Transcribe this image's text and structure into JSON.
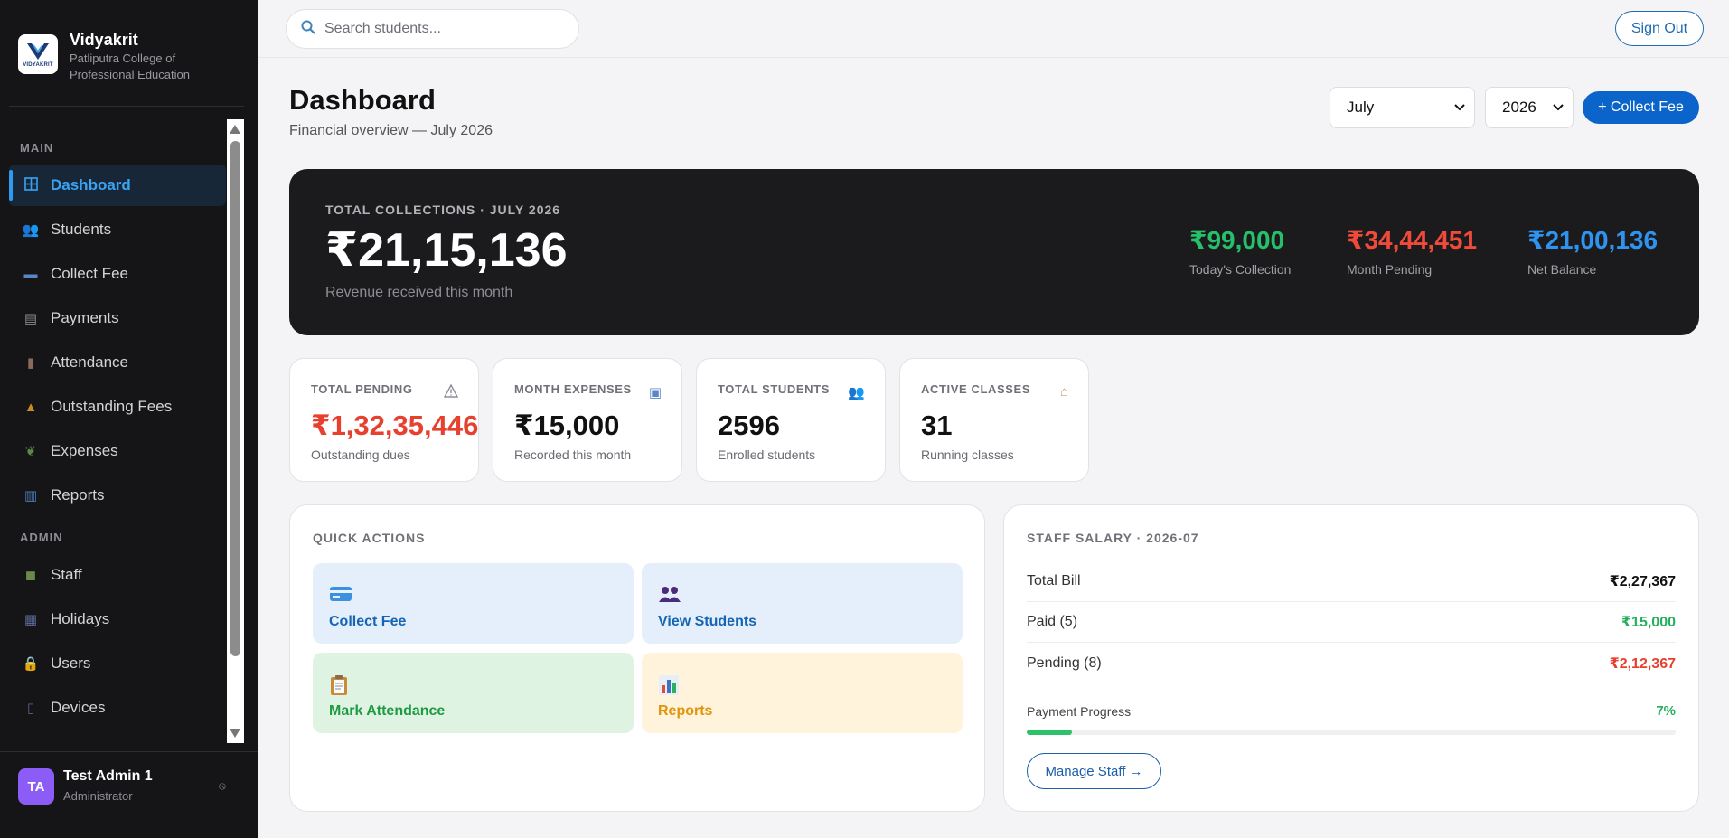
{
  "brand": {
    "name": "Vidyakrit",
    "sub_line1": "Patliputra College of",
    "sub_line2": "Professional Education",
    "logo_text": "VIDYAKRIT"
  },
  "sidebar": {
    "section_main": "MAIN",
    "section_admin": "ADMIN",
    "main_items": [
      {
        "label": "Dashboard",
        "icon": "grid-icon"
      },
      {
        "label": "Students",
        "icon": "users-icon"
      },
      {
        "label": "Collect Fee",
        "icon": "card-icon"
      },
      {
        "label": "Payments",
        "icon": "document-icon"
      },
      {
        "label": "Attendance",
        "icon": "notebook-icon"
      },
      {
        "label": "Outstanding Fees",
        "icon": "warning-icon"
      },
      {
        "label": "Expenses",
        "icon": "leaf-icon"
      },
      {
        "label": "Reports",
        "icon": "bar-chart-icon"
      }
    ],
    "admin_items": [
      {
        "label": "Staff",
        "icon": "staff-icon"
      },
      {
        "label": "Holidays",
        "icon": "calendar-icon"
      },
      {
        "label": "Users",
        "icon": "lock-icon"
      },
      {
        "label": "Devices",
        "icon": "device-icon"
      }
    ],
    "active_item": "Dashboard",
    "accent_color": "#2f9bf0"
  },
  "user": {
    "initials": "TA",
    "name": "Test Admin 1",
    "role": "Administrator"
  },
  "topbar": {
    "search_placeholder": "Search students...",
    "signout_label": "Sign Out"
  },
  "header": {
    "title": "Dashboard",
    "subtitle": "Financial overview — July 2026",
    "month_selected": "July",
    "year_selected": "2026",
    "collect_button": "+ Collect Fee"
  },
  "hero": {
    "label": "TOTAL COLLECTIONS · JULY 2026",
    "value": "₹21,15,136",
    "desc": "Revenue received this month",
    "stats": [
      {
        "value": "₹99,000",
        "label": "Today's Collection",
        "color": "#26c06a"
      },
      {
        "value": "₹34,44,451",
        "label": "Month Pending",
        "color": "#f04a3a"
      },
      {
        "value": "₹21,00,136",
        "label": "Net Balance",
        "color": "#2f93f0"
      }
    ]
  },
  "cards": [
    {
      "label": "TOTAL PENDING",
      "value": "₹1,32,35,446",
      "desc": "Outstanding dues",
      "icon": "warning-icon"
    },
    {
      "label": "MONTH EXPENSES",
      "value": "₹15,000",
      "desc": "Recorded this month",
      "icon": "receipt-icon"
    },
    {
      "label": "TOTAL STUDENTS",
      "value": "2596",
      "desc": "Enrolled students",
      "icon": "users-icon"
    },
    {
      "label": "ACTIVE CLASSES",
      "value": "31",
      "desc": "Running classes",
      "icon": "school-icon"
    }
  ],
  "quick_actions": {
    "title": "QUICK ACTIONS",
    "items": [
      {
        "label": "Collect Fee",
        "icon": "card-icon"
      },
      {
        "label": "View Students",
        "icon": "users-icon"
      },
      {
        "label": "Mark Attendance",
        "icon": "clipboard-icon"
      },
      {
        "label": "Reports",
        "icon": "bar-chart-icon"
      }
    ]
  },
  "salary": {
    "title": "STAFF SALARY · 2026-07",
    "rows": [
      {
        "label": "Total Bill",
        "value": "₹2,27,367"
      },
      {
        "label": "Paid (5)",
        "value": "₹15,000"
      },
      {
        "label": "Pending (8)",
        "value": "₹2,12,367"
      }
    ],
    "progress_label": "Payment Progress",
    "progress_pct_text": "7%",
    "progress_value": 7,
    "manage_button": "Manage Staff →"
  }
}
